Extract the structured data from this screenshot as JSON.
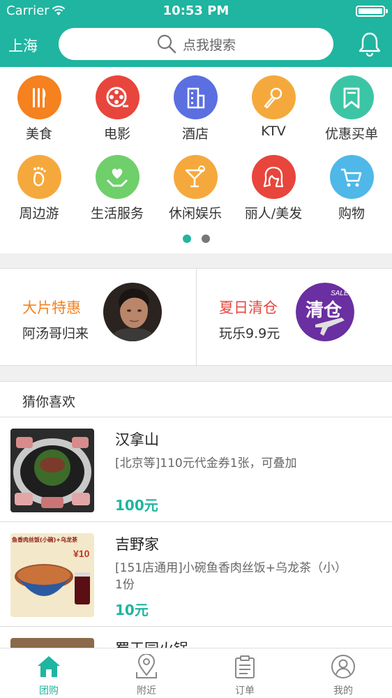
{
  "status_bar": {
    "carrier": "Carrier",
    "time": "10:53 PM"
  },
  "header": {
    "city": "上海",
    "search_placeholder": "点我搜索"
  },
  "categories": [
    {
      "label": "美食",
      "icon": "cutlery-icon",
      "color": "#f5811f"
    },
    {
      "label": "电影",
      "icon": "film-reel-icon",
      "color": "#e8453c"
    },
    {
      "label": "酒店",
      "icon": "building-icon",
      "color": "#5b6fe0"
    },
    {
      "label": "KTV",
      "icon": "microphone-icon",
      "color": "#f5a93c"
    },
    {
      "label": "优惠买单",
      "icon": "bookmark-icon",
      "color": "#3cc5a5"
    },
    {
      "label": "周边游",
      "icon": "footprint-icon",
      "color": "#f5a93c"
    },
    {
      "label": "生活服务",
      "icon": "heart-hand-icon",
      "color": "#6fcf6a"
    },
    {
      "label": "休闲娱乐",
      "icon": "cocktail-icon",
      "color": "#f5a93c"
    },
    {
      "label": "丽人/美发",
      "icon": "woman-face-icon",
      "color": "#e8453c"
    },
    {
      "label": "购物",
      "icon": "cart-icon",
      "color": "#4fb8e8"
    }
  ],
  "promos": [
    {
      "title": "大片特惠",
      "subtitle": "阿汤哥归来",
      "title_color": "#f5811f"
    },
    {
      "title": "夏日清仓",
      "subtitle": "玩乐9.9元",
      "title_color": "#e8453c",
      "badge_text": "清仓",
      "badge_small": "SALE"
    }
  ],
  "section_title": "猜你喜欢",
  "deals": [
    {
      "name": "汉拿山",
      "desc": "[北京等]110元代金券1张，可叠加",
      "price": "100元"
    },
    {
      "name": "吉野家",
      "desc": "[151店通用]小碗鱼香肉丝饭+乌龙茶（小）1份",
      "price": "10元",
      "thumb_text": "鱼香肉丝饭(小碗)+乌龙茶",
      "thumb_price": "¥10"
    },
    {
      "name": "蜀王园火锅",
      "desc": "",
      "price": ""
    }
  ],
  "tabs": [
    {
      "label": "团购",
      "icon": "home-icon",
      "active": true
    },
    {
      "label": "附近",
      "icon": "location-pin-icon",
      "active": false
    },
    {
      "label": "订单",
      "icon": "clipboard-icon",
      "active": false
    },
    {
      "label": "我的",
      "icon": "user-icon",
      "active": false
    }
  ],
  "colors": {
    "brand": "#1fb5a0",
    "inactive_dot": "#777777"
  }
}
